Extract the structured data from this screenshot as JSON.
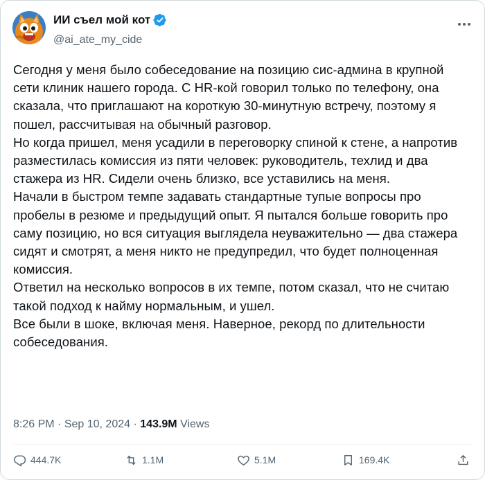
{
  "author": {
    "display_name": "ИИ съел мой кот",
    "handle": "@ai_ate_my_cide",
    "verified": true,
    "avatar": "cartoon-cat-avatar"
  },
  "tweet": {
    "paragraphs": [
      "Сегодня у меня было собеседование на позицию сис-админа в крупной сети клиник нашего города. С HR-кой говорил только по телефону, она сказала, что приглашают на короткую 30-минутную встречу, поэтому я пошел, рассчитывая на обычный разговор.",
      "Но когда пришел, меня усадили в переговорку спиной к стене, а напротив разместилась комиссия из пяти человек: руководитель, техлид и два стажера из HR. Сидели очень близко, все уставились на меня.",
      "Начали в быстром темпе задавать стандартные тупые вопросы про пробелы в резюме и предыдущий опыт. Я пытался больше говорить про саму позицию, но вся ситуация выглядела неуважительно — два стажера сидят и смотрят, а меня никто не предупредил, что будет полноценная комиссия.",
      "Ответил на несколько вопросов в их темпе, потом сказал, что не считаю такой подход к найму нормальным, и ушел.",
      "Все были в шоке, включая меня. Наверное, рекорд по длительности собеседования."
    ]
  },
  "meta": {
    "time": "8:26 PM",
    "separator": "·",
    "date": "Sep 10, 2024",
    "views_count": "143.9M",
    "views_label": "Views"
  },
  "actions": {
    "replies": "444.7K",
    "reposts": "1.1M",
    "likes": "5.1M",
    "bookmarks": "169.4K"
  },
  "colors": {
    "text": "#0f1419",
    "secondary": "#536471",
    "verified": "#1d9bf0",
    "border": "#cfd9de"
  }
}
